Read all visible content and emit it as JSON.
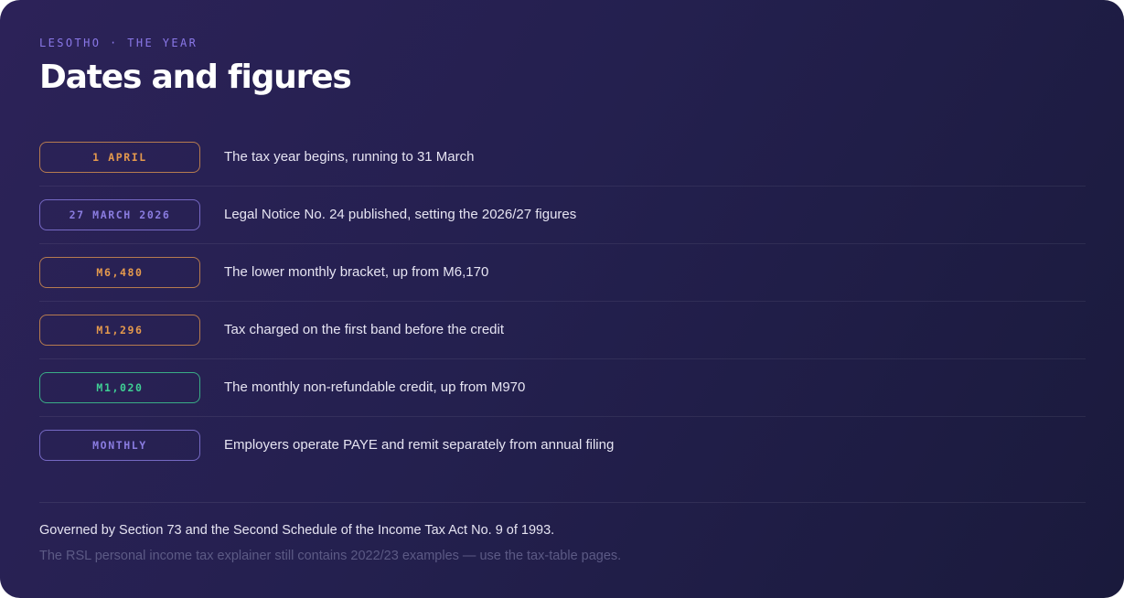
{
  "header": {
    "eyebrow": "LESOTHO · THE YEAR",
    "title": "Dates and figures"
  },
  "rows": [
    {
      "tag": "1 APRIL",
      "tag_color": "orange",
      "text": "The tax year begins, running to 31 March"
    },
    {
      "tag": "27 MARCH 2026",
      "tag_color": "purple",
      "text": "Legal Notice No. 24 published, setting the 2026/27 figures"
    },
    {
      "tag": "M6,480",
      "tag_color": "orange",
      "text": "The lower monthly bracket, up from M6,170"
    },
    {
      "tag": "M1,296",
      "tag_color": "orange",
      "text": "Tax charged on the first band before the credit"
    },
    {
      "tag": "M1,020",
      "tag_color": "green",
      "text": "The monthly non-refundable credit, up from M970"
    },
    {
      "tag": "MONTHLY",
      "tag_color": "purple",
      "text": "Employers operate PAYE and remit separately from annual filing"
    }
  ],
  "footer": {
    "note": "Governed by Section 73 and the Second Schedule of the Income Tax Act No. 9 of 1993.",
    "subnote": "The RSL personal income tax explainer still contains 2022/23 examples — use the tax-table pages."
  },
  "colors": {
    "background": "#241f4f",
    "accent_orange": "#e59a4d",
    "accent_purple": "#8a7ce0",
    "accent_green": "#3fcf94"
  }
}
